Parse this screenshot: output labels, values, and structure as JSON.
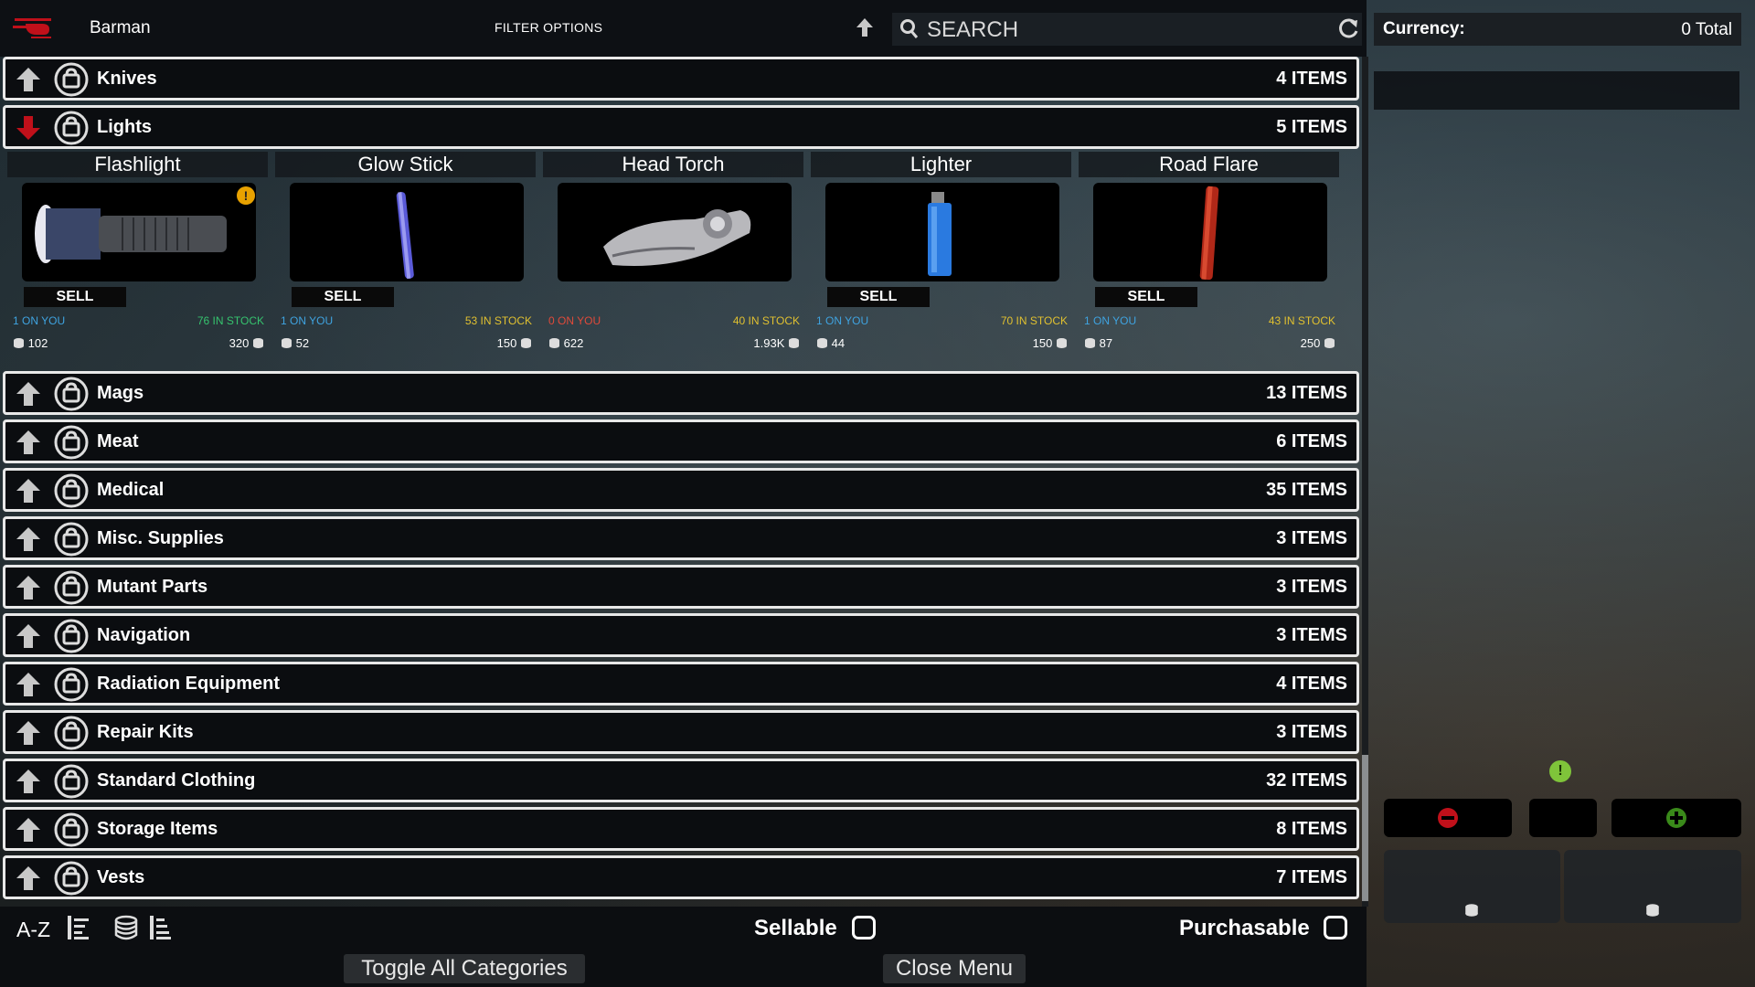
{
  "header": {
    "trader_icon": "helicopter-icon",
    "trader_name": "Barman",
    "filter_options_label": "FILTER OPTIONS",
    "search_placeholder": "SEARCH"
  },
  "currency": {
    "label": "Currency:",
    "total": "0 Total"
  },
  "categories_top": [
    {
      "name": "Knives",
      "count": "4 ITEMS",
      "expanded": false
    },
    {
      "name": "Lights",
      "count": "5 ITEMS",
      "expanded": true
    }
  ],
  "items": [
    {
      "name": "Flashlight",
      "sell_label": "SELL",
      "on_you": "1 ON YOU",
      "in_stock": "76 IN STOCK",
      "sell_price": "102",
      "buy_price": "320",
      "on_you_color": "#3fa3e0",
      "in_stock_color": "#36c36e",
      "warning": "!"
    },
    {
      "name": "Glow Stick",
      "sell_label": "SELL",
      "on_you": "1 ON YOU",
      "in_stock": "53 IN STOCK",
      "sell_price": "52",
      "buy_price": "150",
      "on_you_color": "#3fa3e0",
      "in_stock_color": "#e0c030"
    },
    {
      "name": "Head Torch",
      "sell_label": "",
      "on_you": "0 ON YOU",
      "in_stock": "40 IN STOCK",
      "sell_price": "622",
      "buy_price": "1.93K",
      "on_you_color": "#e04a3a",
      "in_stock_color": "#e0c030"
    },
    {
      "name": "Lighter",
      "sell_label": "SELL",
      "on_you": "1 ON YOU",
      "in_stock": "70 IN STOCK",
      "sell_price": "44",
      "buy_price": "150",
      "on_you_color": "#3fa3e0",
      "in_stock_color": "#e0c030"
    },
    {
      "name": "Road Flare",
      "sell_label": "SELL",
      "on_you": "1 ON YOU",
      "in_stock": "43 IN STOCK",
      "sell_price": "87",
      "buy_price": "250",
      "on_you_color": "#3fa3e0",
      "in_stock_color": "#e0c030"
    }
  ],
  "categories": [
    {
      "name": "Mags",
      "count": "13 ITEMS"
    },
    {
      "name": "Meat",
      "count": "6 ITEMS"
    },
    {
      "name": "Medical",
      "count": "35 ITEMS"
    },
    {
      "name": "Misc. Supplies",
      "count": "3 ITEMS"
    },
    {
      "name": "Mutant Parts",
      "count": "3 ITEMS"
    },
    {
      "name": "Navigation",
      "count": "3 ITEMS"
    },
    {
      "name": "Radiation Equipment",
      "count": "4 ITEMS"
    },
    {
      "name": "Repair Kits",
      "count": "3 ITEMS"
    },
    {
      "name": "Standard Clothing",
      "count": "32 ITEMS"
    },
    {
      "name": "Storage Items",
      "count": "8 ITEMS"
    },
    {
      "name": "Vests",
      "count": "7 ITEMS"
    }
  ],
  "footer": {
    "sort_az": "A-Z",
    "sellable_label": "Sellable",
    "purchasable_label": "Purchasable",
    "toggle_all_label": "Toggle All Categories",
    "close_menu_label": "Close Menu"
  },
  "colors": {
    "collapsed_arrow": "#c8c8c8",
    "expanded_arrow": "#c0101a",
    "minus_button": "#c0101a",
    "plus_button": "#3a8a1a",
    "info_badge": "#7fc43a"
  }
}
